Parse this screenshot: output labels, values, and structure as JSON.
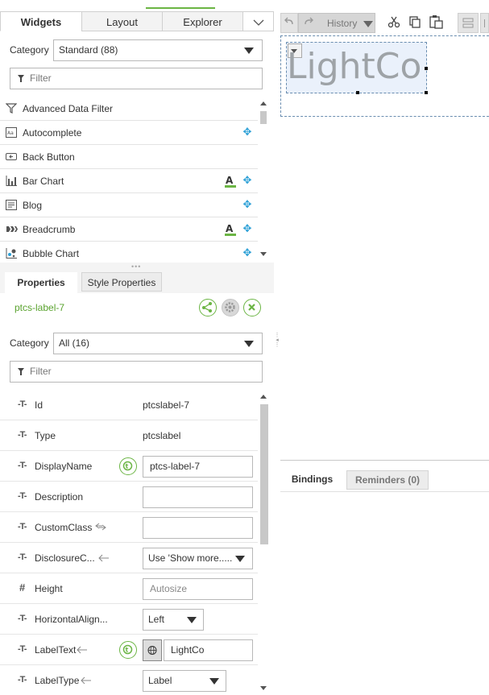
{
  "left_tabs": {
    "widgets": "Widgets",
    "layout": "Layout",
    "explorer": "Explorer"
  },
  "widgets": {
    "category_label": "Category",
    "category_value": "Standard (88)",
    "filter_placeholder": "Filter",
    "items": [
      {
        "label": "Advanced Data Filter",
        "icon": "filter-icon",
        "movable": false,
        "text_badge": false
      },
      {
        "label": "Autocomplete",
        "icon": "autocomplete-icon",
        "movable": true,
        "text_badge": false
      },
      {
        "label": "Back Button",
        "icon": "back-button-icon",
        "movable": false,
        "text_badge": false
      },
      {
        "label": "Bar Chart",
        "icon": "bar-chart-icon",
        "movable": true,
        "text_badge": true
      },
      {
        "label": "Blog",
        "icon": "blog-icon",
        "movable": true,
        "text_badge": false
      },
      {
        "label": "Breadcrumb",
        "icon": "breadcrumb-icon",
        "movable": true,
        "text_badge": true
      },
      {
        "label": "Bubble Chart",
        "icon": "bubble-chart-icon",
        "movable": true,
        "text_badge": false
      }
    ]
  },
  "properties": {
    "tab_properties": "Properties",
    "tab_style": "Style Properties",
    "widget_id": "ptcs-label-7",
    "category_label": "Category",
    "category_value": "All (16)",
    "filter_placeholder": "Filter",
    "rows": [
      {
        "name": "Id",
        "value": "ptcslabel-7"
      },
      {
        "name": "Type",
        "value": "ptcslabel"
      },
      {
        "name": "DisplayName",
        "value": "ptcs-label-7"
      },
      {
        "name": "Description",
        "value": ""
      },
      {
        "name": "CustomClass",
        "value": ""
      },
      {
        "name": "DisclosureC...",
        "value": "Use 'Show more....."
      },
      {
        "name": "Height",
        "placeholder": "Autosize"
      },
      {
        "name": "HorizontalAlign...",
        "value": "Left"
      },
      {
        "name": "LabelText",
        "value": "LightCo"
      },
      {
        "name": "LabelType",
        "value": "Label"
      }
    ]
  },
  "toolbar": {
    "history_label": "History"
  },
  "canvas": {
    "label_text": "LightCo"
  },
  "bottom_tabs": {
    "bindings": "Bindings",
    "reminders": "Reminders (0)"
  },
  "colors": {
    "accent_green": "#6bb544",
    "move_blue": "#2a9fd6"
  }
}
